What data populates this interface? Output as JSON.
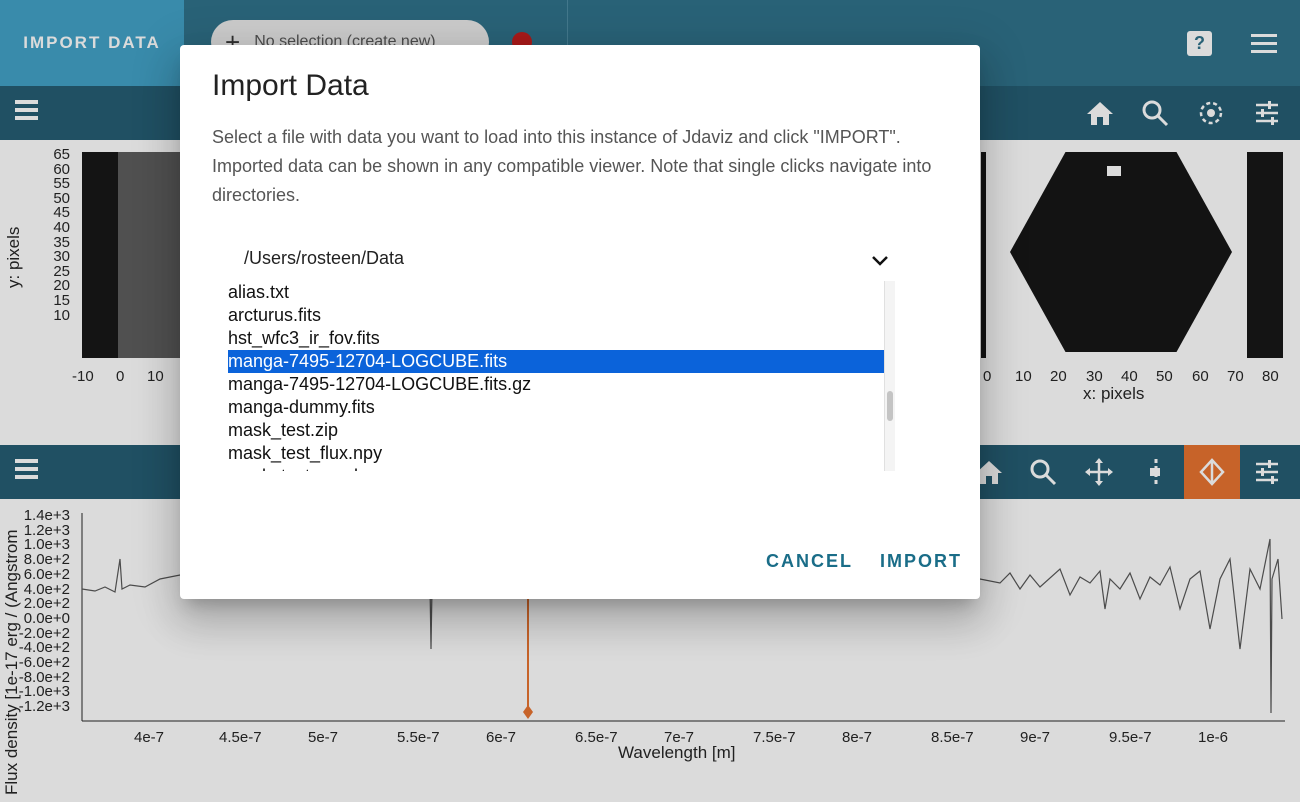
{
  "topbar": {
    "import_tab_label": "IMPORT DATA",
    "subset_placeholder": "No selection (create new)",
    "help_label": "?"
  },
  "image_viewer": {
    "ylabel": "y: pixels",
    "xlabel": "x: pixels",
    "y_ticks": [
      "65",
      "60",
      "55",
      "50",
      "45",
      "40",
      "35",
      "30",
      "25",
      "20",
      "15",
      "10"
    ],
    "x_ticks_left": [
      "-10",
      "0",
      "10"
    ],
    "x_ticks_right": [
      "0",
      "10",
      "20",
      "30",
      "40",
      "50",
      "60",
      "70",
      "80"
    ]
  },
  "spectrum_viewer": {
    "ylabel": "Flux density [1e-17 erg / (Angstrom",
    "xlabel": "Wavelength [m]",
    "y_ticks": [
      "1.4e+3",
      "1.2e+3",
      "1.0e+3",
      "8.0e+2",
      "6.0e+2",
      "4.0e+2",
      "2.0e+2",
      "0.0e+0",
      "-2.0e+2",
      "-4.0e+2",
      "-6.0e+2",
      "-8.0e+2",
      "-1.0e+3",
      "-1.2e+3"
    ],
    "x_ticks": [
      "4e-7",
      "4.5e-7",
      "5e-7",
      "5.5e-7",
      "6e-7",
      "6.5e-7",
      "7e-7",
      "7.5e-7",
      "8e-7",
      "8.5e-7",
      "9e-7",
      "9.5e-7",
      "1e-6"
    ],
    "accent_color": "#e8702c"
  },
  "dialog": {
    "title": "Import Data",
    "description": "Select a file with data you want to load into this instance of Jdaviz and click \"IMPORT\". Imported data can be shown in any compatible viewer. Note that single clicks navigate into directories.",
    "current_path": "/Users/rosteen/Data",
    "files": [
      "alias.txt",
      "arcturus.fits",
      "hst_wfc3_ir_fov.fits",
      "manga-7495-12704-LOGCUBE.fits",
      "manga-7495-12704-LOGCUBE.fits.gz",
      "manga-dummy.fits",
      "mask_test.zip",
      "mask_test_flux.npy",
      "mask_test_mask.npy"
    ],
    "selected_file": "manga-7495-12704-LOGCUBE.fits",
    "cancel_label": "CANCEL",
    "import_label": "IMPORT",
    "selection_color": "#0b63da",
    "button_color": "#1a6d88"
  }
}
